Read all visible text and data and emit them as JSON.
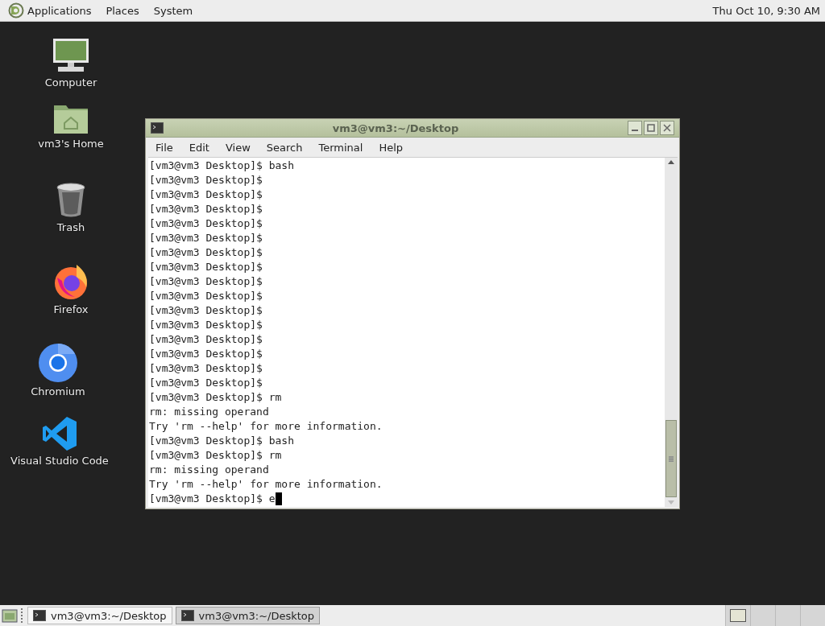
{
  "top_panel": {
    "menus": [
      "Applications",
      "Places",
      "System"
    ],
    "clock": "Thu Oct 10,  9:30 AM"
  },
  "desktop_icons": [
    {
      "label": "Computer",
      "kind": "computer"
    },
    {
      "label": "vm3's Home",
      "kind": "home"
    },
    {
      "label": "Trash",
      "kind": "trash"
    },
    {
      "label": "Firefox",
      "kind": "firefox"
    },
    {
      "label": "Chromium",
      "kind": "chromium"
    },
    {
      "label": "Visual Studio Code",
      "kind": "vscode"
    }
  ],
  "window": {
    "title": "vm3@vm3:~/Desktop",
    "menus": [
      "File",
      "Edit",
      "View",
      "Search",
      "Terminal",
      "Help"
    ],
    "lines": [
      "[vm3@vm3 Desktop]$ bash",
      "[vm3@vm3 Desktop]$",
      "[vm3@vm3 Desktop]$",
      "[vm3@vm3 Desktop]$",
      "[vm3@vm3 Desktop]$",
      "[vm3@vm3 Desktop]$",
      "[vm3@vm3 Desktop]$",
      "[vm3@vm3 Desktop]$",
      "[vm3@vm3 Desktop]$",
      "[vm3@vm3 Desktop]$",
      "[vm3@vm3 Desktop]$",
      "[vm3@vm3 Desktop]$",
      "[vm3@vm3 Desktop]$",
      "[vm3@vm3 Desktop]$",
      "[vm3@vm3 Desktop]$",
      "[vm3@vm3 Desktop]$",
      "[vm3@vm3 Desktop]$ rm",
      "rm: missing operand",
      "Try 'rm --help' for more information.",
      "[vm3@vm3 Desktop]$ bash",
      "[vm3@vm3 Desktop]$ rm",
      "rm: missing operand",
      "Try 'rm --help' for more information."
    ],
    "input_line": "[vm3@vm3 Desktop]$ e"
  },
  "taskbar": {
    "tasks": [
      {
        "label": "vm3@vm3:~/Desktop",
        "selected": false
      },
      {
        "label": "vm3@vm3:~/Desktop",
        "selected": true
      }
    ],
    "workspaces": [
      {
        "selected": true
      },
      {
        "selected": false
      },
      {
        "selected": false
      },
      {
        "selected": false
      }
    ]
  }
}
